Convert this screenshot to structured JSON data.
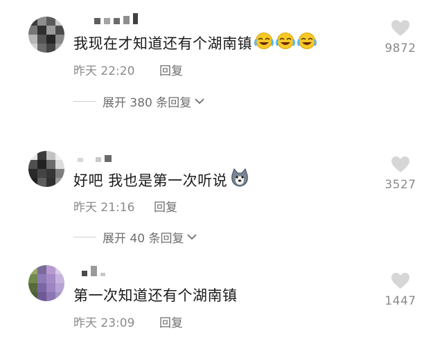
{
  "comments": [
    {
      "text": "我现在才知道还有个湖南镇",
      "emojis": [
        "laugh-cry-emoji",
        "laugh-cry-emoji",
        "laugh-cry-emoji"
      ],
      "time": "昨天 22:20",
      "reply": "回复",
      "expand": "展开 380 条回复",
      "likes": "9872"
    },
    {
      "text": "好吧 我也是第一次听说",
      "emojis": [
        "husky-dog-emoji"
      ],
      "time": "昨天 21:16",
      "reply": "回复",
      "expand": "展开 40 条回复",
      "likes": "3527"
    },
    {
      "text": "第一次知道还有个湖南镇",
      "emojis": [],
      "time": "昨天 23:09",
      "reply": "回复",
      "likes": "1447"
    }
  ],
  "icons": {
    "like": "heart-icon",
    "expand": "chevron-down-icon"
  },
  "colors": {
    "text": "#1a1a1a",
    "meta": "#8a8a8a",
    "heart": "#d6d6d6",
    "emoji_face": "#f7c928"
  }
}
